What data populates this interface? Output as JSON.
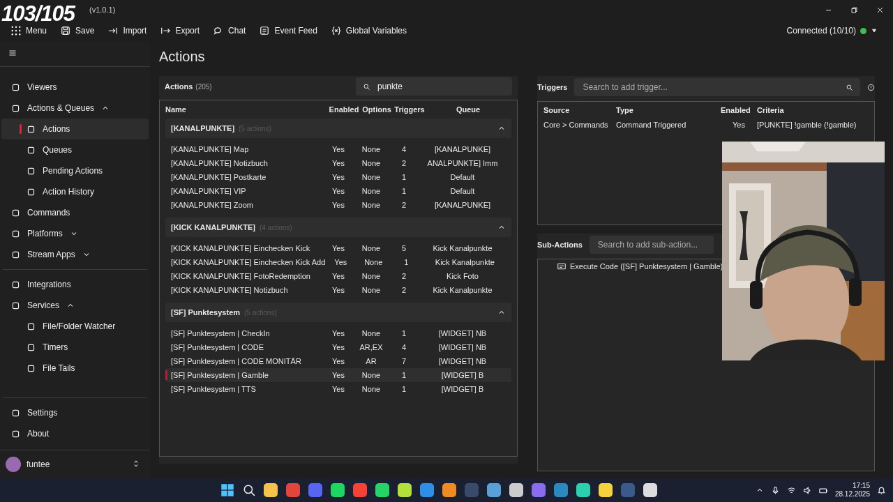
{
  "overlay_counter": "103/105",
  "window": {
    "title": "(v1.0.1)"
  },
  "toolbar": [
    {
      "label": "Menu",
      "kind": "menu"
    },
    {
      "label": "Save",
      "kind": "save"
    },
    {
      "label": "Import",
      "kind": "import"
    },
    {
      "label": "Export",
      "kind": "export"
    },
    {
      "label": "Chat",
      "kind": "chat"
    },
    {
      "label": "Event Feed",
      "kind": "feed"
    },
    {
      "label": "Global Variables",
      "kind": "vars"
    }
  ],
  "connection": {
    "label": "Connected (10/10)",
    "connected": true
  },
  "sidebar": {
    "items": [
      {
        "label": "Viewers",
        "selected": false
      },
      {
        "label": "Actions & Queues",
        "selected": false,
        "expanded": true,
        "children": [
          {
            "label": "Actions",
            "selected": true
          },
          {
            "label": "Queues",
            "selected": false
          },
          {
            "label": "Pending Actions",
            "selected": false
          },
          {
            "label": "Action History",
            "selected": false
          }
        ]
      },
      {
        "label": "Commands",
        "selected": false
      },
      {
        "label": "Platforms",
        "selected": false,
        "expanded": false
      },
      {
        "label": "Stream Apps",
        "selected": false,
        "expanded": false
      },
      {
        "label": "Integrations",
        "selected": false
      },
      {
        "label": "Services",
        "selected": false,
        "expanded": true,
        "children": [
          {
            "label": "File/Folder Watcher",
            "selected": false
          },
          {
            "label": "Timers",
            "selected": false
          },
          {
            "label": "File Tails",
            "selected": false
          }
        ]
      }
    ],
    "footer": [
      {
        "label": "Settings",
        "selected": false
      },
      {
        "label": "About",
        "selected": false
      }
    ],
    "user": {
      "name": "funtee"
    }
  },
  "page_title": "Actions",
  "actions": {
    "title": "Actions",
    "count": "(205)",
    "search": {
      "value": "punkte"
    },
    "columns": [
      "Name",
      "Enabled",
      "Options",
      "Triggers",
      "Queue"
    ],
    "groups": [
      {
        "name": "[KANALPUNKTE]",
        "count": "(5 actions)",
        "expanded": true,
        "rows": [
          {
            "name": "[KANALPUNKTE] Map",
            "enabled": "Yes",
            "options": "None",
            "triggers": "4",
            "queue": "[KANALPUNKE]",
            "selected": false
          },
          {
            "name": "[KANALPUNKTE] Notizbuch",
            "enabled": "Yes",
            "options": "None",
            "triggers": "2",
            "queue": "ANALPUNKTE] Imm",
            "selected": false
          },
          {
            "name": "[KANALPUNKTE] Postkarte",
            "enabled": "Yes",
            "options": "None",
            "triggers": "1",
            "queue": "Default",
            "selected": false
          },
          {
            "name": "[KANALPUNKTE] VIP",
            "enabled": "Yes",
            "options": "None",
            "triggers": "1",
            "queue": "Default",
            "selected": false
          },
          {
            "name": "[KANALPUNKTE] Zoom",
            "enabled": "Yes",
            "options": "None",
            "triggers": "2",
            "queue": "[KANALPUNKE]",
            "selected": false
          }
        ]
      },
      {
        "name": "[KICK KANALPUNKTE]",
        "count": "(4 actions)",
        "expanded": true,
        "rows": [
          {
            "name": "[KICK KANALPUNKTE] Einchecken Kick",
            "enabled": "Yes",
            "options": "None",
            "triggers": "5",
            "queue": "Kick Kanalpunkte",
            "selected": false
          },
          {
            "name": "[KICK KANALPUNKTE] Einchecken Kick Add",
            "enabled": "Yes",
            "options": "None",
            "triggers": "1",
            "queue": "Kick Kanalpunkte",
            "selected": false
          },
          {
            "name": "[KICK KANALPUNKTE] FotoRedemption",
            "enabled": "Yes",
            "options": "None",
            "triggers": "2",
            "queue": "Kick Foto",
            "selected": false
          },
          {
            "name": "[KICK KANALPUNKTE] Notizbuch",
            "enabled": "Yes",
            "options": "None",
            "triggers": "2",
            "queue": "Kick Kanalpunkte",
            "selected": false
          }
        ]
      },
      {
        "name": "[SF] Punktesystem",
        "count": "(5 actions)",
        "expanded": true,
        "rows": [
          {
            "name": "[SF] Punktesystem | CheckIn",
            "enabled": "Yes",
            "options": "None",
            "triggers": "1",
            "queue": "[WIDGET] NB",
            "selected": false
          },
          {
            "name": "[SF] Punktesystem | CODE",
            "enabled": "Yes",
            "options": "AR,EX",
            "triggers": "4",
            "queue": "[WIDGET] NB",
            "selected": false
          },
          {
            "name": "[SF] Punktesystem | CODE MONITÄR",
            "enabled": "Yes",
            "options": "AR",
            "triggers": "7",
            "queue": "[WIDGET] NB",
            "selected": false
          },
          {
            "name": "[SF] Punktesystem | Gamble",
            "enabled": "Yes",
            "options": "None",
            "triggers": "1",
            "queue": "[WIDGET] B",
            "selected": true
          },
          {
            "name": "[SF] Punktesystem | TTS",
            "enabled": "Yes",
            "options": "None",
            "triggers": "1",
            "queue": "[WIDGET] B",
            "selected": false
          }
        ]
      }
    ]
  },
  "triggers": {
    "title": "Triggers",
    "search": {
      "placeholder": "Search to add trigger..."
    },
    "columns": [
      "Source",
      "Type",
      "Enabled",
      "Criteria"
    ],
    "rows": [
      {
        "source": "Core > Commands",
        "type": "Command Triggered",
        "enabled": "Yes",
        "criteria": "[PUNKTE] !gamble (!gamble)"
      }
    ]
  },
  "sub_actions": {
    "title": "Sub-Actions",
    "search": {
      "placeholder": "Search to add sub-action..."
    },
    "items": [
      {
        "label": "Execute Code ([SF] Punktesystem | Gamble)"
      }
    ]
  },
  "taskbar": {
    "time": "17:15",
    "date": "28.12.2025"
  }
}
